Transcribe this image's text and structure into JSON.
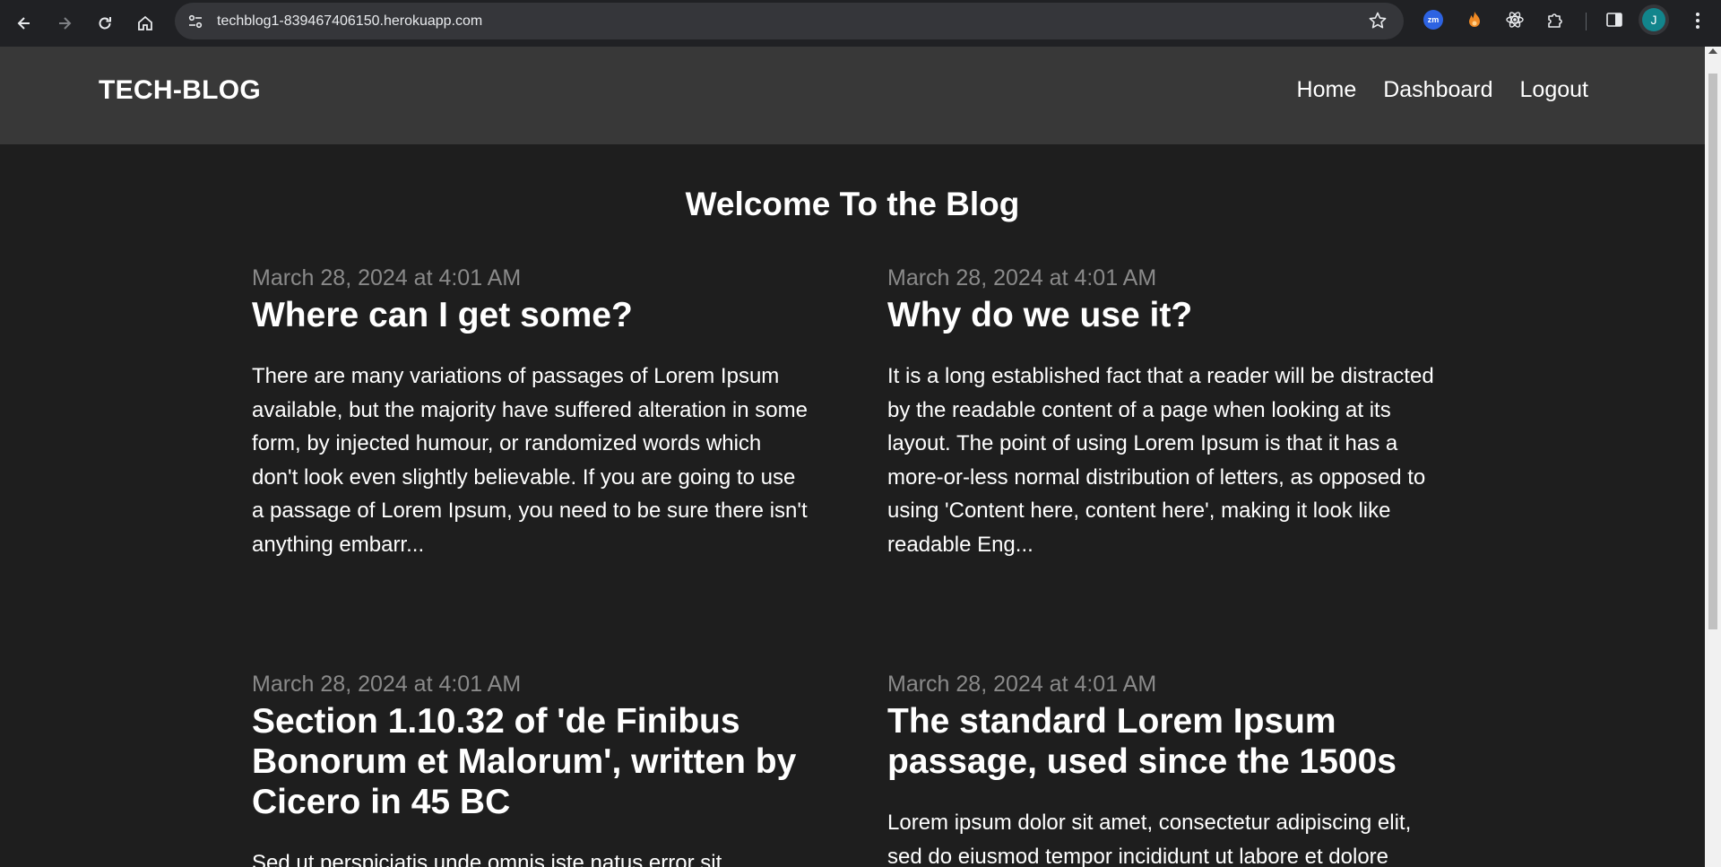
{
  "browser": {
    "url": "techblog1-839467406150.herokuapp.com",
    "avatar_initial": "J",
    "extensions": [
      "zm",
      "flame-icon",
      "react-icon",
      "puzzle-icon"
    ],
    "ext_zm_label": "zm"
  },
  "site": {
    "brand": "TECH-BLOG",
    "nav": [
      "Home",
      "Dashboard",
      "Logout"
    ],
    "welcome": "Welcome To the Blog"
  },
  "posts": [
    {
      "date": "March 28, 2024 at 4:01 AM",
      "title": "Where can I get some?",
      "body": "There are many variations of passages of Lorem Ipsum available, but the majority have suffered alteration in some form, by injected humour, or randomized words which don't look even slightly believable. If you are going to use a passage of Lorem Ipsum, you need to be sure there isn't anything embarr..."
    },
    {
      "date": "March 28, 2024 at 4:01 AM",
      "title": "Why do we use it?",
      "body": "It is a long established fact that a reader will be distracted by the readable content of a page when looking at its layout. The point of using Lorem Ipsum is that it has a more-or-less normal distribution of letters, as opposed to using 'Content here, content here', making it look like readable Eng..."
    },
    {
      "date": "March 28, 2024 at 4:01 AM",
      "title": "Section 1.10.32 of 'de Finibus Bonorum et Malorum', written by Cicero in 45 BC",
      "body": "Sed ut perspiciatis unde omnis iste natus error sit"
    },
    {
      "date": "March 28, 2024 at 4:01 AM",
      "title": "The standard Lorem Ipsum passage, used since the 1500s",
      "body": "Lorem ipsum dolor sit amet, consectetur adipiscing elit, sed do eiusmod tempor incididunt ut labore et dolore"
    }
  ]
}
